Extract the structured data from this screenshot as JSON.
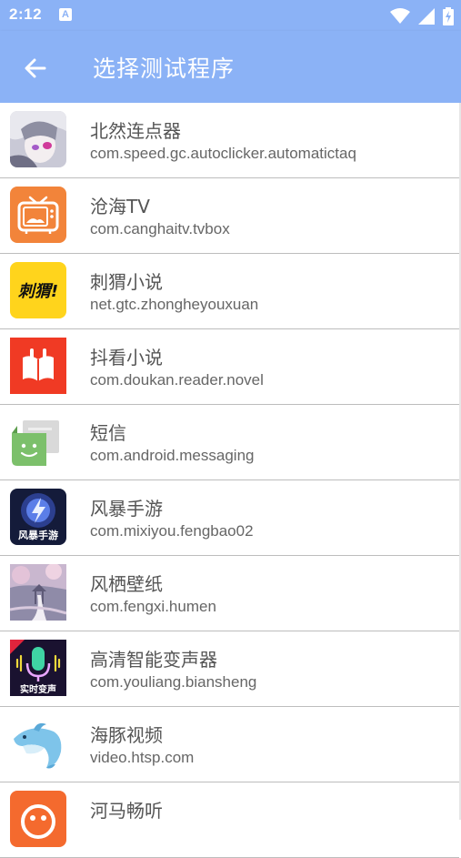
{
  "status_bar": {
    "time": "2:12",
    "notif_letter": "A"
  },
  "app_bar": {
    "title": "选择测试程序",
    "back_icon": "arrow-left-icon"
  },
  "apps": [
    {
      "name": "北然连点器",
      "package": "com.speed.gc.autoclicker.automatictaq",
      "icon": "anime-girl-icon"
    },
    {
      "name": "沧海TV",
      "package": "com.canghaitv.tvbox",
      "icon": "tv-icon"
    },
    {
      "name": "刺猬小说",
      "package": "net.gtc.zhongheyouxuan",
      "icon": "cihu-logo-icon",
      "icon_text": "刺猬!"
    },
    {
      "name": "抖看小说",
      "package": "com.doukan.reader.novel",
      "icon": "open-book-icon"
    },
    {
      "name": "短信",
      "package": "com.android.messaging",
      "icon": "message-smiley-icon"
    },
    {
      "name": "风暴手游",
      "package": "com.mixiyou.fengbao02",
      "icon": "storm-logo-icon",
      "icon_text": "风暴手游"
    },
    {
      "name": "风栖壁纸",
      "package": "com.fengxi.humen",
      "icon": "wallpaper-icon"
    },
    {
      "name": "高清智能变声器",
      "package": "com.youliang.biansheng",
      "icon": "microphone-icon",
      "icon_text": "实时变声"
    },
    {
      "name": "海豚视频",
      "package": "video.htsp.com",
      "icon": "dolphin-icon"
    },
    {
      "name": "河马畅听",
      "package": "",
      "icon": "hippo-icon"
    }
  ],
  "colors": {
    "primary": "#8bb2f6",
    "divider": "#bdbdbd",
    "text": "#555555"
  }
}
